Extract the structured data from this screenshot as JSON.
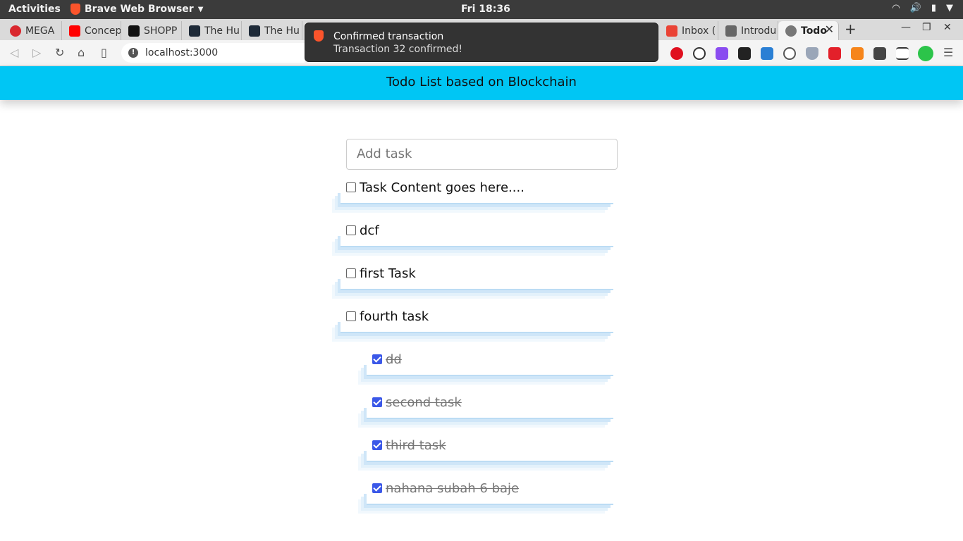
{
  "system": {
    "activities": "Activities",
    "app_name": "Brave Web Browser",
    "clock": "Fri 18:36"
  },
  "tabs": [
    {
      "label": "MEGA"
    },
    {
      "label": "Concep"
    },
    {
      "label": "SHOPP"
    },
    {
      "label": "The Hu"
    },
    {
      "label": "The Hu"
    },
    {
      "label": "Inbox ("
    },
    {
      "label": "Introdu"
    },
    {
      "label": "Todo"
    }
  ],
  "toolbar": {
    "url": "localhost:3000"
  },
  "notification": {
    "title": "Confirmed transaction",
    "body": "Transaction 32 confirmed!"
  },
  "page": {
    "title": "Todo List based on Blockchain",
    "add_task_placeholder": "Add task",
    "tasks": [
      {
        "label": "Task Content goes here....",
        "completed": false
      },
      {
        "label": "dcf",
        "completed": false
      },
      {
        "label": "first Task",
        "completed": false
      },
      {
        "label": "fourth task",
        "completed": false
      },
      {
        "label": "dd",
        "completed": true
      },
      {
        "label": "second task",
        "completed": true
      },
      {
        "label": "third task",
        "completed": true
      },
      {
        "label": "nahana subah 6 baje",
        "completed": true
      }
    ]
  },
  "colors": {
    "header_bg": "#00c6f4",
    "checkbox_checked": "#3b58e8"
  }
}
